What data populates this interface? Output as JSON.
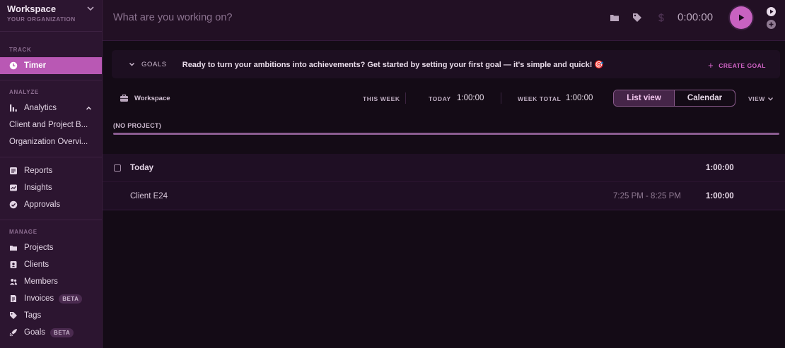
{
  "workspace": {
    "title": "Workspace",
    "subtitle": "YOUR ORGANIZATION"
  },
  "sidebar": {
    "track_label": "TRACK",
    "timer": "Timer",
    "analyze_label": "ANALYZE",
    "analytics": "Analytics",
    "analytics_sub": [
      "Client and Project B...",
      "Organization Overvi..."
    ],
    "reports": "Reports",
    "insights": "Insights",
    "approvals": "Approvals",
    "manage_label": "MANAGE",
    "projects": "Projects",
    "clients": "Clients",
    "members": "Members",
    "invoices": "Invoices",
    "invoices_badge": "BETA",
    "tags": "Tags",
    "goals": "Goals",
    "goals_badge": "BETA"
  },
  "topbar": {
    "placeholder": "What are you working on?",
    "timer": "0:00:00"
  },
  "goals_bar": {
    "label": "GOALS",
    "text": "Ready to turn your ambitions into achievements? Get started by setting your first goal — it's simple and quick! 🎯",
    "create": "CREATE GOAL"
  },
  "toolbar": {
    "workspace": "Workspace",
    "this_week": "THIS WEEK",
    "today_label": "TODAY",
    "today_value": "1:00:00",
    "week_total_label": "WEEK TOTAL",
    "week_total_value": "1:00:00",
    "list_view": "List view",
    "calendar": "Calendar",
    "view": "VIEW"
  },
  "project": {
    "name": "(NO PROJECT)",
    "share": 1.0
  },
  "day": {
    "label": "Today",
    "total": "1:00:00",
    "entry": {
      "description": "Client E24",
      "range": "7:25 PM - 8:25 PM",
      "duration": "1:00:00"
    }
  },
  "colors": {
    "accent": "#c862c1",
    "sidebar": "#2c1530",
    "background": "#140b16"
  }
}
